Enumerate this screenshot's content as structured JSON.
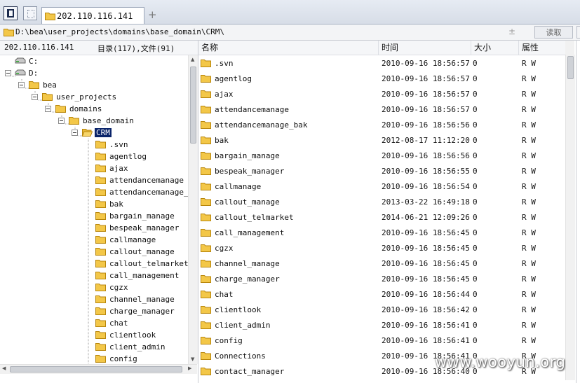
{
  "tab": {
    "label": "202.110.116.141"
  },
  "toolbar": {
    "add_tab": "+"
  },
  "path": {
    "value": "D:\\bea\\user_projects\\domains\\base_domain\\CRM\\",
    "dropdown": "±",
    "read_button": "读取"
  },
  "left_panel": {
    "host": "202.110.116.141",
    "summary": "目录(117),文件(91)",
    "tree": [
      {
        "label": "C:",
        "level": 0,
        "type": "drive",
        "toggle": false
      },
      {
        "label": "D:",
        "level": 0,
        "type": "drive",
        "toggle": true
      },
      {
        "label": "bea",
        "level": 1,
        "type": "folder",
        "toggle": true
      },
      {
        "label": "user_projects",
        "level": 2,
        "type": "folder",
        "toggle": true
      },
      {
        "label": "domains",
        "level": 3,
        "type": "folder",
        "toggle": true
      },
      {
        "label": "base_domain",
        "level": 4,
        "type": "folder",
        "toggle": true
      },
      {
        "label": "CRM",
        "level": 5,
        "type": "open-folder",
        "toggle": true,
        "selected": true
      },
      {
        "label": ".svn",
        "level": 6,
        "type": "folder",
        "toggle": false
      },
      {
        "label": "agentlog",
        "level": 6,
        "type": "folder",
        "toggle": false
      },
      {
        "label": "ajax",
        "level": 6,
        "type": "folder",
        "toggle": false
      },
      {
        "label": "attendancemanage",
        "level": 6,
        "type": "folder",
        "toggle": false
      },
      {
        "label": "attendancemanage_ba",
        "level": 6,
        "type": "folder",
        "toggle": false
      },
      {
        "label": "bak",
        "level": 6,
        "type": "folder",
        "toggle": false
      },
      {
        "label": "bargain_manage",
        "level": 6,
        "type": "folder",
        "toggle": false
      },
      {
        "label": "bespeak_manager",
        "level": 6,
        "type": "folder",
        "toggle": false
      },
      {
        "label": "callmanage",
        "level": 6,
        "type": "folder",
        "toggle": false
      },
      {
        "label": "callout_manage",
        "level": 6,
        "type": "folder",
        "toggle": false
      },
      {
        "label": "callout_telmarket",
        "level": 6,
        "type": "folder",
        "toggle": false
      },
      {
        "label": "call_management",
        "level": 6,
        "type": "folder",
        "toggle": false
      },
      {
        "label": "cgzx",
        "level": 6,
        "type": "folder",
        "toggle": false
      },
      {
        "label": "channel_manage",
        "level": 6,
        "type": "folder",
        "toggle": false
      },
      {
        "label": "charge_manager",
        "level": 6,
        "type": "folder",
        "toggle": false
      },
      {
        "label": "chat",
        "level": 6,
        "type": "folder",
        "toggle": false
      },
      {
        "label": "clientlook",
        "level": 6,
        "type": "folder",
        "toggle": false
      },
      {
        "label": "client_admin",
        "level": 6,
        "type": "folder",
        "toggle": false
      },
      {
        "label": "config",
        "level": 6,
        "type": "folder",
        "toggle": false
      }
    ]
  },
  "file_list": {
    "columns": {
      "name": "名称",
      "time": "时间",
      "size": "大小",
      "attr": "属性"
    },
    "rows": [
      {
        "name": ".svn",
        "time": "2010-09-16 18:56:57",
        "size": "0",
        "attr": "R W"
      },
      {
        "name": "agentlog",
        "time": "2010-09-16 18:56:57",
        "size": "0",
        "attr": "R W"
      },
      {
        "name": "ajax",
        "time": "2010-09-16 18:56:57",
        "size": "0",
        "attr": "R W"
      },
      {
        "name": "attendancemanage",
        "time": "2010-09-16 18:56:57",
        "size": "0",
        "attr": "R W"
      },
      {
        "name": "attendancemanage_bak",
        "time": "2010-09-16 18:56:56",
        "size": "0",
        "attr": "R W"
      },
      {
        "name": "bak",
        "time": "2012-08-17 11:12:20",
        "size": "0",
        "attr": "R W"
      },
      {
        "name": "bargain_manage",
        "time": "2010-09-16 18:56:56",
        "size": "0",
        "attr": "R W"
      },
      {
        "name": "bespeak_manager",
        "time": "2010-09-16 18:56:55",
        "size": "0",
        "attr": "R W"
      },
      {
        "name": "callmanage",
        "time": "2010-09-16 18:56:54",
        "size": "0",
        "attr": "R W"
      },
      {
        "name": "callout_manage",
        "time": "2013-03-22 16:49:18",
        "size": "0",
        "attr": "R W"
      },
      {
        "name": "callout_telmarket",
        "time": "2014-06-21 12:09:26",
        "size": "0",
        "attr": "R W"
      },
      {
        "name": "call_management",
        "time": "2010-09-16 18:56:45",
        "size": "0",
        "attr": "R W"
      },
      {
        "name": "cgzx",
        "time": "2010-09-16 18:56:45",
        "size": "0",
        "attr": "R W"
      },
      {
        "name": "channel_manage",
        "time": "2010-09-16 18:56:45",
        "size": "0",
        "attr": "R W"
      },
      {
        "name": "charge_manager",
        "time": "2010-09-16 18:56:45",
        "size": "0",
        "attr": "R W"
      },
      {
        "name": "chat",
        "time": "2010-09-16 18:56:44",
        "size": "0",
        "attr": "R W"
      },
      {
        "name": "clientlook",
        "time": "2010-09-16 18:56:42",
        "size": "0",
        "attr": "R W"
      },
      {
        "name": "client_admin",
        "time": "2010-09-16 18:56:41",
        "size": "0",
        "attr": "R W"
      },
      {
        "name": "config",
        "time": "2010-09-16 18:56:41",
        "size": "0",
        "attr": "R W"
      },
      {
        "name": "Connections",
        "time": "2010-09-16 18:56:41",
        "size": "0",
        "attr": "R W"
      },
      {
        "name": "contact_manager",
        "time": "2010-09-16 18:56:40",
        "size": "0",
        "attr": "R W"
      }
    ]
  },
  "watermark": "www.wooyun.org",
  "icons": {
    "folder": "folder-icon",
    "drive": "drive-icon"
  },
  "colors": {
    "folder": "#f3c748",
    "folder_edge": "#b8860b",
    "selection": "#0a246a"
  }
}
